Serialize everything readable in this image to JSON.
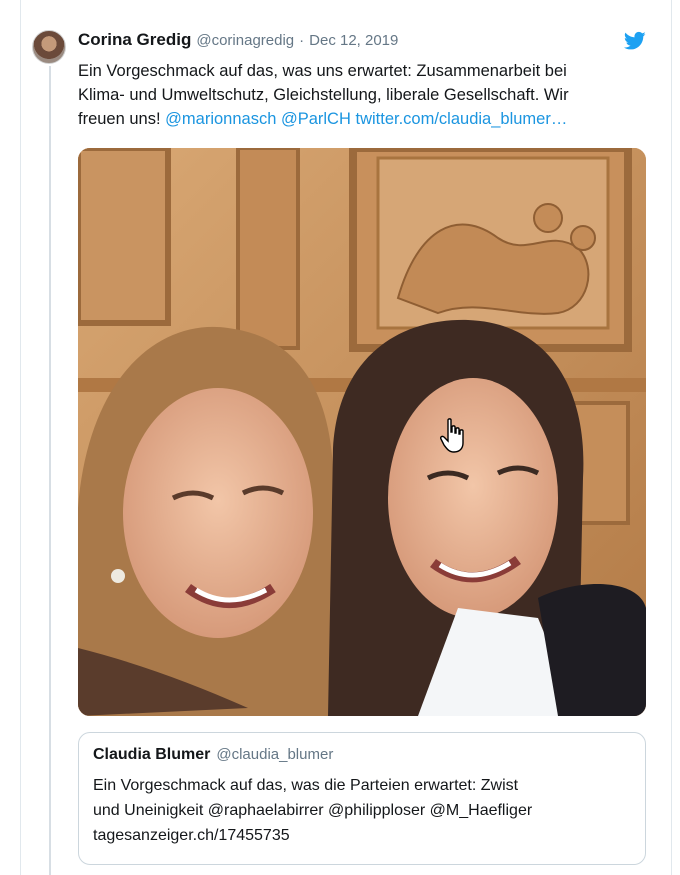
{
  "tweet": {
    "author_name": "Corina Gredig",
    "author_handle": "@corinagredig",
    "separator": "·",
    "date": "Dec 12, 2019",
    "text_line1": "Ein Vorgeschmack auf das, was uns erwartet: Zusammenarbeit bei",
    "text_line2": "Klima- und Umweltschutz, Gleichstellung, liberale Gesellschaft. Wir",
    "text_line3_prefix": "freuen uns!",
    "mention1": "@marionnasch",
    "mention2": "@ParlCH",
    "link": "twitter.com/claudia_blumer…"
  },
  "quoted_tweet": {
    "author_name": "Claudia Blumer",
    "author_handle": "@claudia_blumer",
    "text_line1": "Ein Vorgeschmack auf das, was die Parteien erwartet: Zwist",
    "text_line2": "und Uneinigkeit @raphaelabirrer @philipploser @M_Haefliger",
    "text_line3": "tagesanzeiger.ch/17455735"
  },
  "icons": {
    "bird": "twitter-bird-icon",
    "cursor": "hand-pointer-icon"
  },
  "colors": {
    "link": "#1b95e0",
    "muted": "#657786",
    "text": "#14171a",
    "border": "#ccd6dd"
  }
}
